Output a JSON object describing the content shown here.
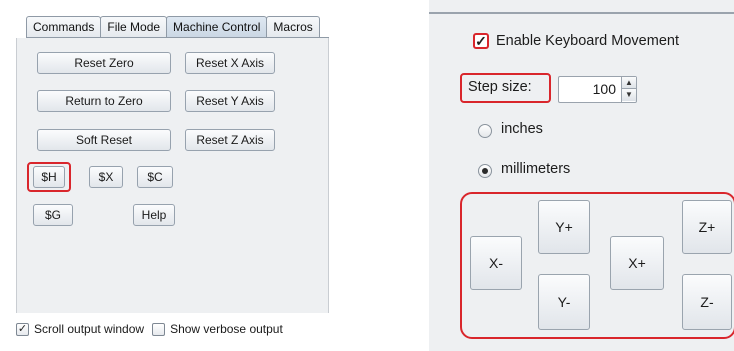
{
  "left_panel": {
    "tabs": [
      {
        "label": "Commands",
        "active": false
      },
      {
        "label": "File Mode",
        "active": false
      },
      {
        "label": "Machine Control",
        "active": true
      },
      {
        "label": "Macros",
        "active": false
      }
    ],
    "buttons": {
      "reset_zero": "Reset Zero",
      "reset_x_axis": "Reset X Axis",
      "return_to_zero": "Return to Zero",
      "reset_y_axis": "Reset Y Axis",
      "soft_reset": "Soft Reset",
      "reset_z_axis": "Reset Z Axis",
      "cmd_h": "$H",
      "cmd_x": "$X",
      "cmd_c": "$C",
      "cmd_g": "$G",
      "help": "Help"
    },
    "options": {
      "scroll_output_label": "Scroll output window",
      "scroll_output_checked": true,
      "verbose_label": "Show verbose output",
      "verbose_checked": false
    }
  },
  "right_panel": {
    "keyboard_movement_label": "Enable Keyboard Movement",
    "keyboard_movement_checked": true,
    "step_size_label": "Step size:",
    "step_size_value": "100",
    "units": [
      {
        "label": "inches",
        "selected": false
      },
      {
        "label": "millimeters",
        "selected": true
      }
    ],
    "jog_buttons": {
      "x_minus": "X-",
      "y_plus": "Y+",
      "y_minus": "Y-",
      "x_plus": "X+",
      "z_plus": "Z+",
      "z_minus": "Z-"
    }
  },
  "colors": {
    "highlight": "#d9262c",
    "panel_bg": "#eef0f2",
    "border": "#97a2ae"
  },
  "icons": {
    "checkmark": "checkmark-icon",
    "spinner_up": "arrow-up-icon",
    "spinner_down": "arrow-down-icon"
  }
}
